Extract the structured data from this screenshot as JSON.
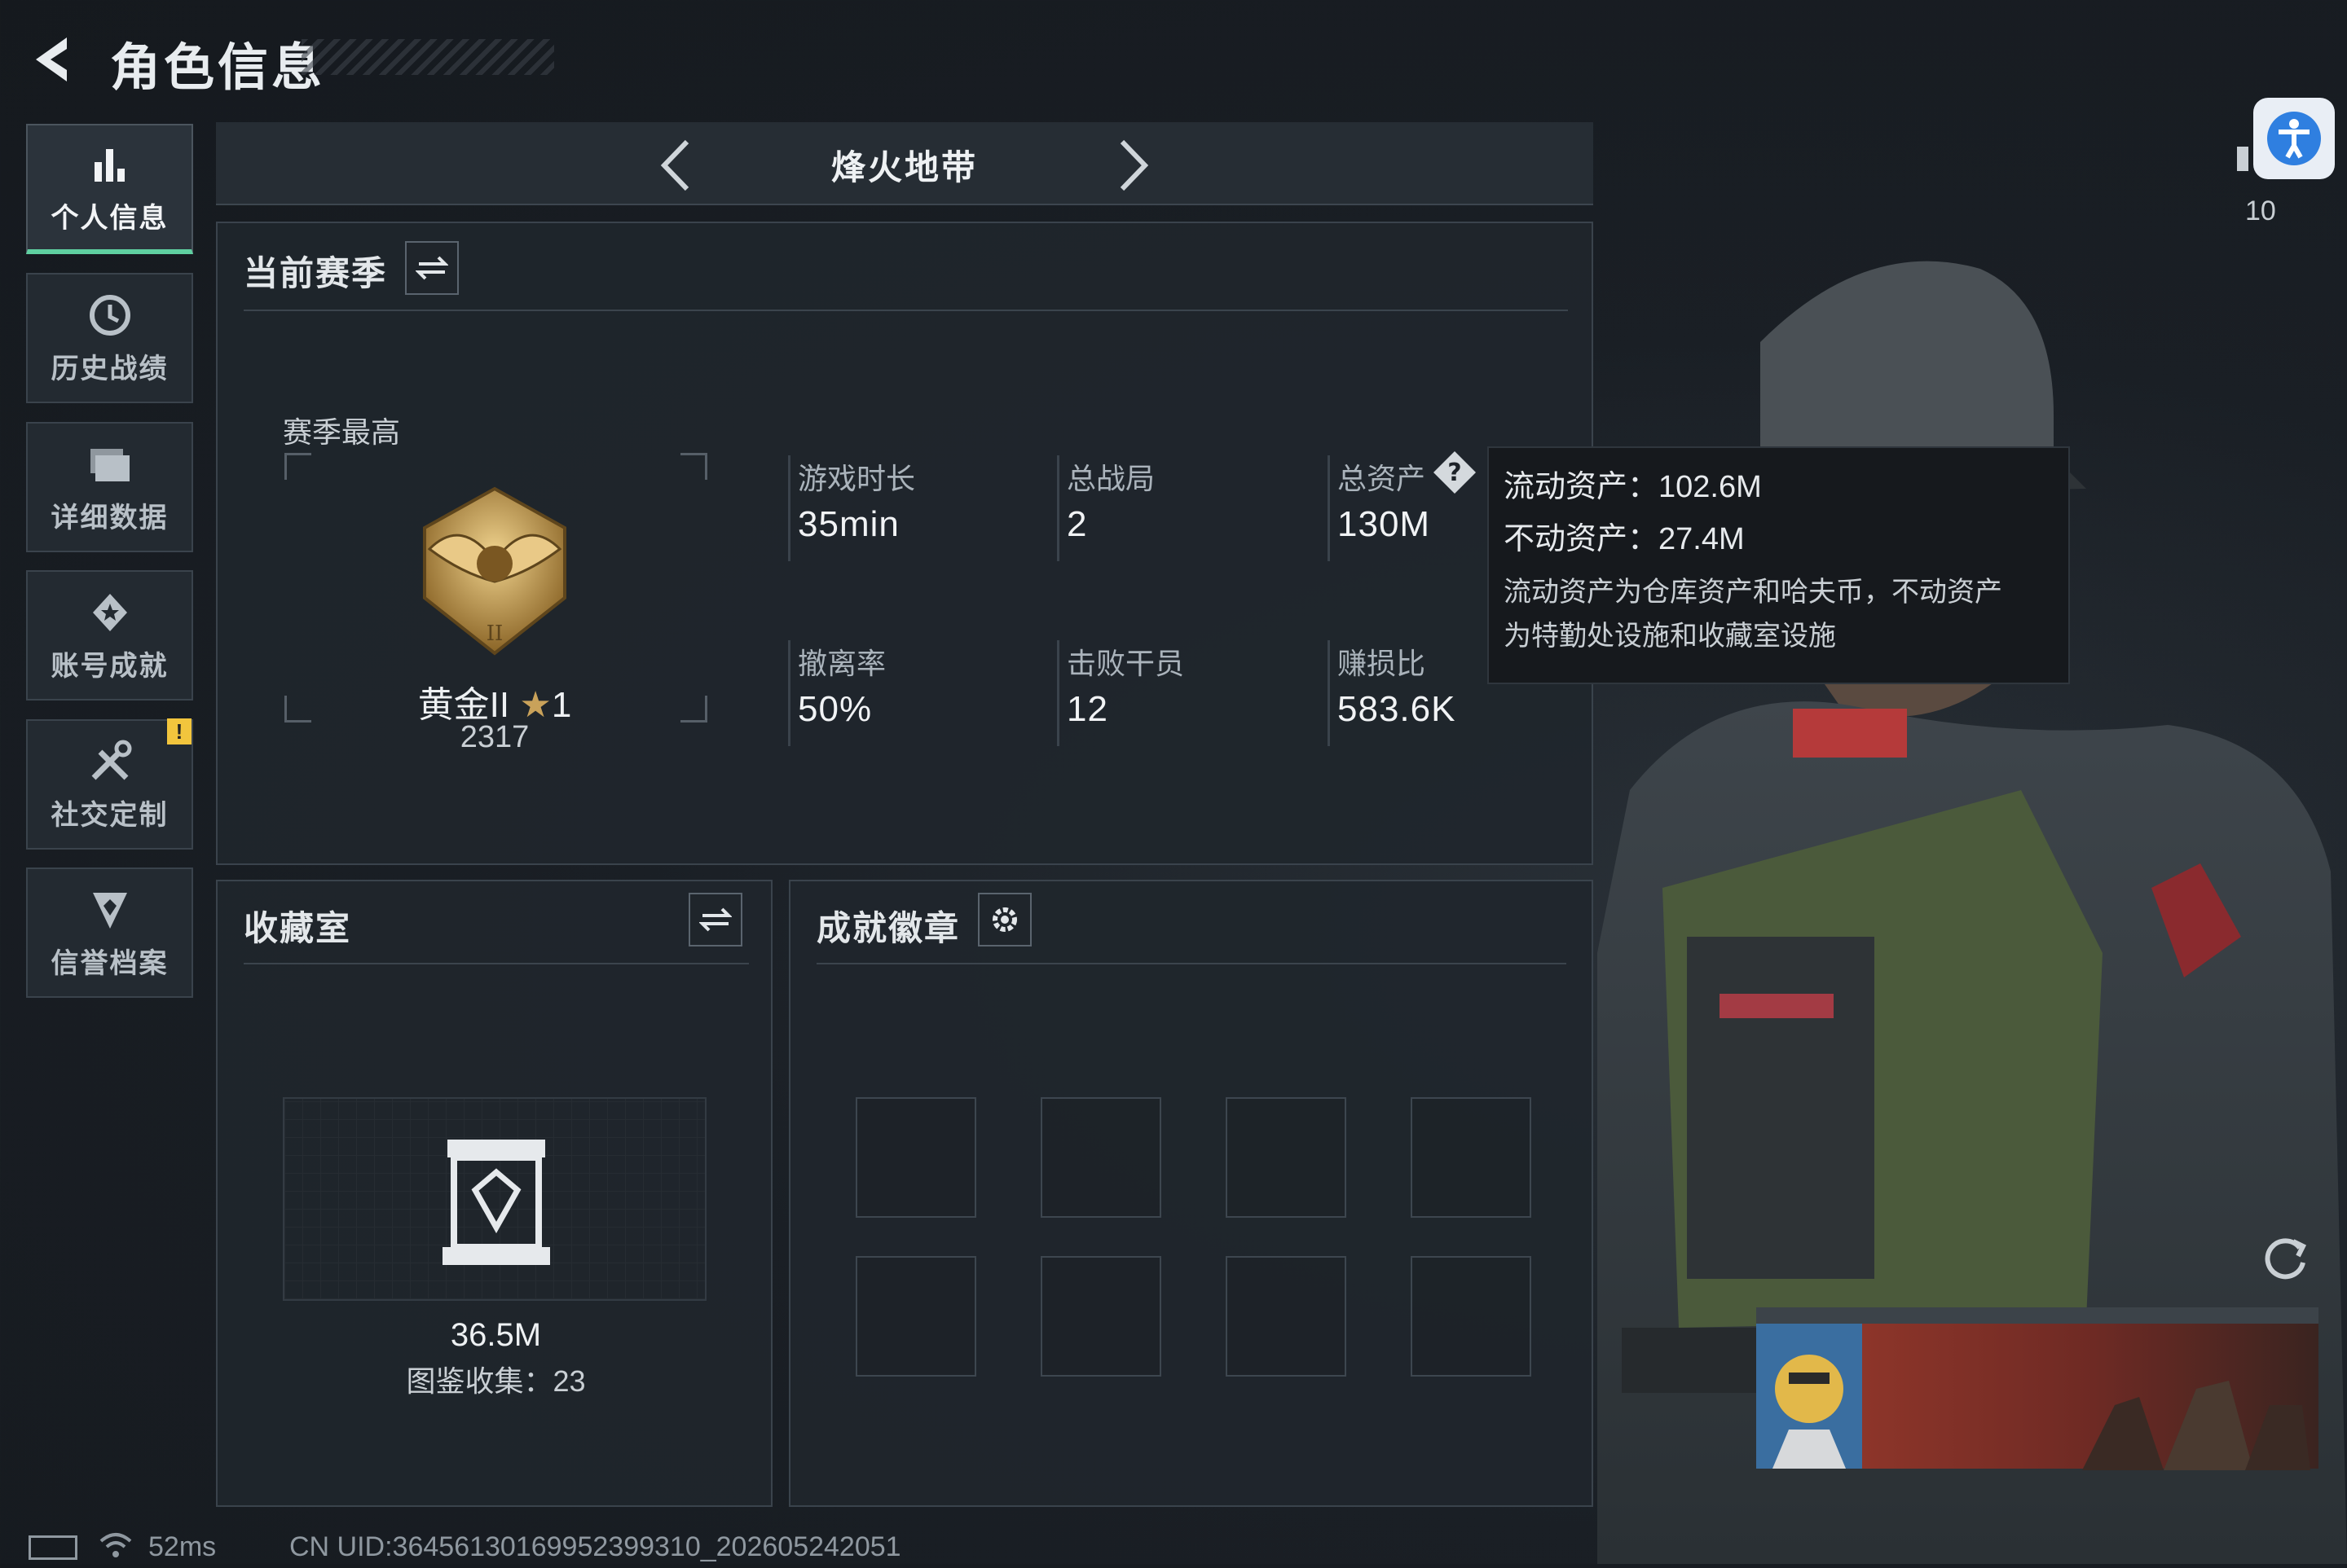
{
  "header": {
    "title": "角色信息"
  },
  "sidebar": {
    "items": [
      {
        "label": "个人信息",
        "icon": "bar-chart-icon",
        "active": true
      },
      {
        "label": "历史战绩",
        "icon": "history-icon"
      },
      {
        "label": "详细数据",
        "icon": "folder-icon"
      },
      {
        "label": "账号成就",
        "icon": "achievement-icon"
      },
      {
        "label": "社交定制",
        "icon": "tools-icon",
        "badge": "!"
      },
      {
        "label": "信誉档案",
        "icon": "credit-shield-icon"
      }
    ]
  },
  "mode_selector": {
    "name": "烽火地带"
  },
  "season": {
    "title": "当前赛季",
    "best_label": "赛季最高",
    "rank_name": "黄金II",
    "rank_stars": "1",
    "rank_score": "2317",
    "stats": [
      {
        "label": "游戏时长",
        "value": "35min"
      },
      {
        "label": "总战局",
        "value": "2"
      },
      {
        "label": "总资产",
        "value": "130M"
      },
      {
        "label": "撤离率",
        "value": "50%"
      },
      {
        "label": "击败干员",
        "value": "12"
      },
      {
        "label": "赚损比",
        "value": "583.6K"
      }
    ]
  },
  "asset_tooltip": {
    "liquid": "流动资产：102.6M",
    "fixed": "不动资产：27.4M",
    "note_line1": "流动资产为仓库资产和哈夫币，不动资产",
    "note_line2": "为特勤处设施和收藏室设施"
  },
  "collection": {
    "title": "收藏室",
    "value": "36.5M",
    "catalog": "图鉴收集：23"
  },
  "achievements": {
    "title": "成就徽章",
    "slots": 8
  },
  "top_right": {
    "count": "10"
  },
  "status_bar": {
    "ping": "52ms",
    "uid": "CN UID:36456130169952399310_202605242051"
  },
  "colors": {
    "accent_green": "#5fd0a1",
    "warning": "#f2c53d",
    "gold": "#c9a25a",
    "access_blue": "#2f7fe0"
  }
}
